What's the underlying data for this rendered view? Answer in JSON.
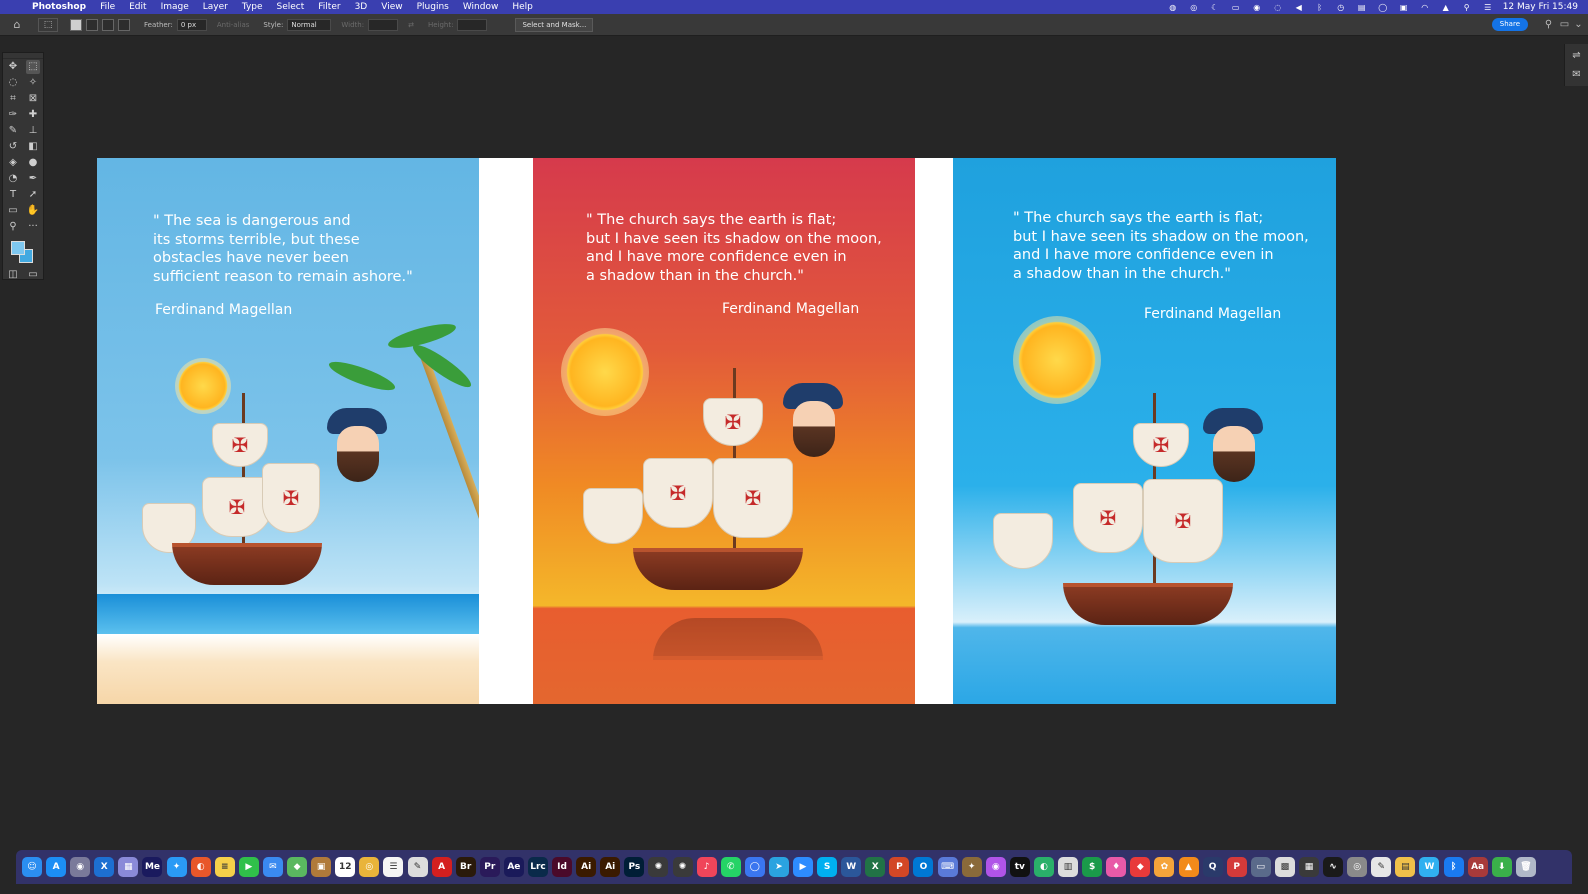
{
  "menubar": {
    "app": "Photoshop",
    "items": [
      "File",
      "Edit",
      "Image",
      "Layer",
      "Type",
      "Select",
      "Filter",
      "3D",
      "View",
      "Plugins",
      "Window",
      "Help"
    ],
    "clock": "12 May Fri  15:49"
  },
  "optbar": {
    "feather_label": "Feather:",
    "feather_value": "0 px",
    "antialias_label": "Anti-alias",
    "style_label": "Style:",
    "style_value": "Normal",
    "width_label": "Width:",
    "height_label": "Height:",
    "select_mask_label": "Select and Mask...",
    "share_label": "Share"
  },
  "posters": [
    {
      "quote": "\" The sea is dangerous and\nits storms terrible, but these\nobstacles have never been\nsufficient reason to remain ashore.\"",
      "author": "Ferdinand Magellan"
    },
    {
      "quote": "\" The church says the earth is flat;\nbut I have seen its shadow on the moon,\nand I have more confidence even in\na shadow than in the church.\"",
      "author": "Ferdinand Magellan"
    },
    {
      "quote": "\" The church says the earth is flat;\nbut I have seen its shadow on the moon,\nand I have more confidence even in\na shadow than in the church.\"",
      "author": "Ferdinand Magellan"
    }
  ],
  "colors": {
    "foreground": "#7ec8f0",
    "background": "#42a9e1",
    "menubar": "#3a3fb0",
    "accent": "#1473e6"
  },
  "dock": {
    "items": [
      {
        "icon": "finder-icon",
        "color": "#2b8ef0",
        "glyph": "☺"
      },
      {
        "icon": "app-store-icon",
        "color": "#1c8ef5",
        "glyph": "A"
      },
      {
        "icon": "network-radar-icon",
        "color": "#7a7a9a",
        "glyph": "◉"
      },
      {
        "icon": "xcode-icon",
        "color": "#1d6fd1",
        "glyph": "X"
      },
      {
        "icon": "launchpad-icon",
        "color": "#8a8ad8",
        "glyph": "▦"
      },
      {
        "icon": "media-encoder-icon",
        "color": "#1a1a5e",
        "glyph": "Me"
      },
      {
        "icon": "safari-icon",
        "color": "#2a9af5",
        "glyph": "✦"
      },
      {
        "icon": "firefox-icon",
        "color": "#e8572a",
        "glyph": "◐"
      },
      {
        "icon": "notes-icon",
        "color": "#f5d04a",
        "glyph": "≡"
      },
      {
        "icon": "facetime-icon",
        "color": "#30c04a",
        "glyph": "▶"
      },
      {
        "icon": "mail-icon",
        "color": "#3a8af0",
        "glyph": "✉"
      },
      {
        "icon": "maps-icon",
        "color": "#5ab860",
        "glyph": "◆"
      },
      {
        "icon": "bear-icon",
        "color": "#b07a3a",
        "glyph": "▣"
      },
      {
        "icon": "calendar-icon",
        "color": "#ffffff",
        "glyph": "12"
      },
      {
        "icon": "chrome-icon",
        "color": "#e9b43a",
        "glyph": "◎"
      },
      {
        "icon": "reminders-icon",
        "color": "#f4f4f4",
        "glyph": "☰"
      },
      {
        "icon": "preview-icon",
        "color": "#dcdcdc",
        "glyph": "✎"
      },
      {
        "icon": "acrobat-icon",
        "color": "#d41f1f",
        "glyph": "A"
      },
      {
        "icon": "bridge-icon",
        "color": "#2a1a0a",
        "glyph": "Br"
      },
      {
        "icon": "premiere-icon",
        "color": "#2a1a5a",
        "glyph": "Pr"
      },
      {
        "icon": "after-effects-icon",
        "color": "#1a1a5a",
        "glyph": "Ae"
      },
      {
        "icon": "lightroom-icon",
        "color": "#0a2a4a",
        "glyph": "Lrc"
      },
      {
        "icon": "indesign-icon",
        "color": "#4a0a2a",
        "glyph": "Id"
      },
      {
        "icon": "illustrator-icon",
        "color": "#3a1a00",
        "glyph": "Ai"
      },
      {
        "icon": "illustrator-2-icon",
        "color": "#3a1a00",
        "glyph": "Ai"
      },
      {
        "icon": "photoshop-icon",
        "color": "#001e36",
        "glyph": "Ps"
      },
      {
        "icon": "davinci-icon",
        "color": "#3a3a3a",
        "glyph": "✺"
      },
      {
        "icon": "resolve-icon",
        "color": "#3a3a3a",
        "glyph": "✺"
      },
      {
        "icon": "music-icon",
        "color": "#f0455a",
        "glyph": "♪"
      },
      {
        "icon": "whatsapp-icon",
        "color": "#25d366",
        "glyph": "✆"
      },
      {
        "icon": "signal-icon",
        "color": "#3a76f0",
        "glyph": "◯"
      },
      {
        "icon": "telegram-icon",
        "color": "#2aa3e0",
        "glyph": "➤"
      },
      {
        "icon": "zoom-icon",
        "color": "#2d8cff",
        "glyph": "▶"
      },
      {
        "icon": "skype-icon",
        "color": "#00aff0",
        "glyph": "S"
      },
      {
        "icon": "word-icon",
        "color": "#2b579a",
        "glyph": "W"
      },
      {
        "icon": "excel-icon",
        "color": "#217346",
        "glyph": "X"
      },
      {
        "icon": "powerpoint-icon",
        "color": "#d24726",
        "glyph": "P"
      },
      {
        "icon": "outlook-icon",
        "color": "#0078d4",
        "glyph": "O"
      },
      {
        "icon": "keyboard-icon",
        "color": "#5a7ad8",
        "glyph": "⌨"
      },
      {
        "icon": "steam-icon",
        "color": "#8a6a3a",
        "glyph": "✦"
      },
      {
        "icon": "podcasts-icon",
        "color": "#b054e8",
        "glyph": "◉"
      },
      {
        "icon": "apple-tv-icon",
        "color": "#111111",
        "glyph": "tv"
      },
      {
        "icon": "vpn-icon",
        "color": "#2ab06a",
        "glyph": "◐"
      },
      {
        "icon": "cleanmymac-icon",
        "color": "#dcdcdc",
        "glyph": "▥"
      },
      {
        "icon": "money-icon",
        "color": "#1a9a4a",
        "glyph": "$"
      },
      {
        "icon": "cleaner-icon",
        "color": "#e85aa8",
        "glyph": "♦"
      },
      {
        "icon": "setapp-icon",
        "color": "#e83a3a",
        "glyph": "◆"
      },
      {
        "icon": "photos-icon",
        "color": "#f5a43a",
        "glyph": "✿"
      },
      {
        "icon": "vlc-icon",
        "color": "#f28a1a",
        "glyph": "▲"
      },
      {
        "icon": "proxyman-icon",
        "color": "#2a3a6a",
        "glyph": "Q"
      },
      {
        "icon": "pdf-expert-icon",
        "color": "#d43a3a",
        "glyph": "P"
      },
      {
        "icon": "screenshot-icon",
        "color": "#5a6a8a",
        "glyph": "▭"
      },
      {
        "icon": "chess-icon",
        "color": "#dcdcdc",
        "glyph": "▩"
      },
      {
        "icon": "calculator-icon",
        "color": "#3a3a3a",
        "glyph": "▦"
      },
      {
        "icon": "activity-monitor-icon",
        "color": "#1a1a1a",
        "glyph": "∿"
      },
      {
        "icon": "disk-utility-icon",
        "color": "#8a8a8a",
        "glyph": "◎"
      },
      {
        "icon": "script-editor-icon",
        "color": "#e6e6e6",
        "glyph": "✎"
      },
      {
        "icon": "archive-icon",
        "color": "#f0c04a",
        "glyph": "▤"
      },
      {
        "icon": "webex-icon",
        "color": "#30b0f0",
        "glyph": "W"
      },
      {
        "icon": "bluetooth-icon",
        "color": "#1a7af0",
        "glyph": "ᛒ"
      },
      {
        "icon": "dictionary-icon",
        "color": "#a83a3a",
        "glyph": "Aa"
      },
      {
        "icon": "downloads-icon",
        "color": "#3ab04a",
        "glyph": "⬇"
      },
      {
        "icon": "trash-icon",
        "color": "#b0b8c8",
        "glyph": "🗑"
      }
    ]
  }
}
